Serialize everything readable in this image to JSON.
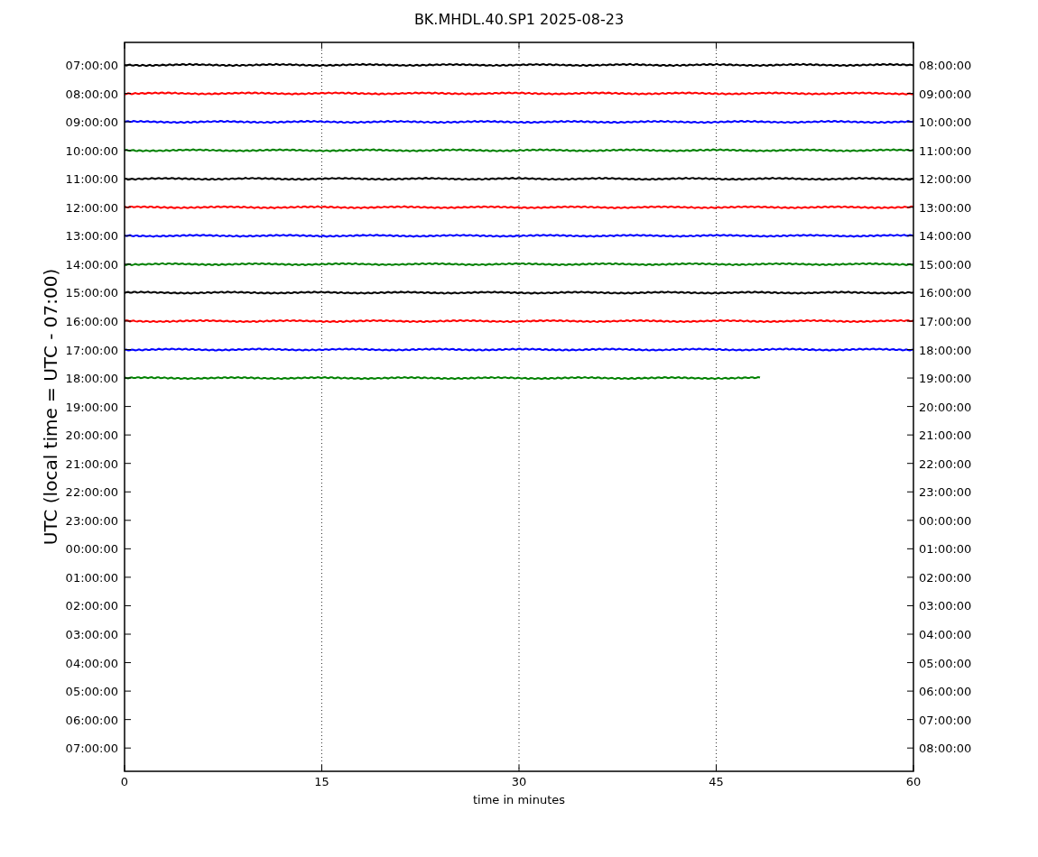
{
  "title": "BK.MHDL.40.SP1 2025-08-23",
  "ylabel": "UTC (local time = UTC - 07:00)",
  "xlabel": "time in minutes",
  "xticks": [
    "0",
    "15",
    "30",
    "45",
    "60"
  ],
  "left_ticks": [
    "07:00:00",
    "08:00:00",
    "09:00:00",
    "10:00:00",
    "11:00:00",
    "12:00:00",
    "13:00:00",
    "14:00:00",
    "15:00:00",
    "16:00:00",
    "17:00:00",
    "18:00:00",
    "19:00:00",
    "20:00:00",
    "21:00:00",
    "22:00:00",
    "23:00:00",
    "00:00:00",
    "01:00:00",
    "02:00:00",
    "03:00:00",
    "04:00:00",
    "05:00:00",
    "06:00:00",
    "07:00:00"
  ],
  "right_ticks": [
    "08:00:00",
    "09:00:00",
    "10:00:00",
    "11:00:00",
    "12:00:00",
    "13:00:00",
    "14:00:00",
    "15:00:00",
    "16:00:00",
    "17:00:00",
    "18:00:00",
    "19:00:00",
    "20:00:00",
    "21:00:00",
    "22:00:00",
    "23:00:00",
    "00:00:00",
    "01:00:00",
    "02:00:00",
    "03:00:00",
    "04:00:00",
    "05:00:00",
    "06:00:00",
    "07:00:00",
    "08:00:00"
  ],
  "traces": [
    {
      "color": "#000000",
      "level": 1
    },
    {
      "color": "#ff0000",
      "level": 1
    },
    {
      "color": "#0000ff",
      "level": 1
    },
    {
      "color": "#008000",
      "level": 1
    },
    {
      "color": "#000000",
      "level": 1
    },
    {
      "color": "#ff0000",
      "level": 1
    },
    {
      "color": "#0000ff",
      "level": 1
    },
    {
      "color": "#008000",
      "level": 1
    },
    {
      "color": "#000000",
      "level": 1
    },
    {
      "color": "#ff0000",
      "level": 1
    },
    {
      "color": "#0000ff",
      "level": 1
    },
    {
      "color": "#008000",
      "level": 0.807
    }
  ]
}
